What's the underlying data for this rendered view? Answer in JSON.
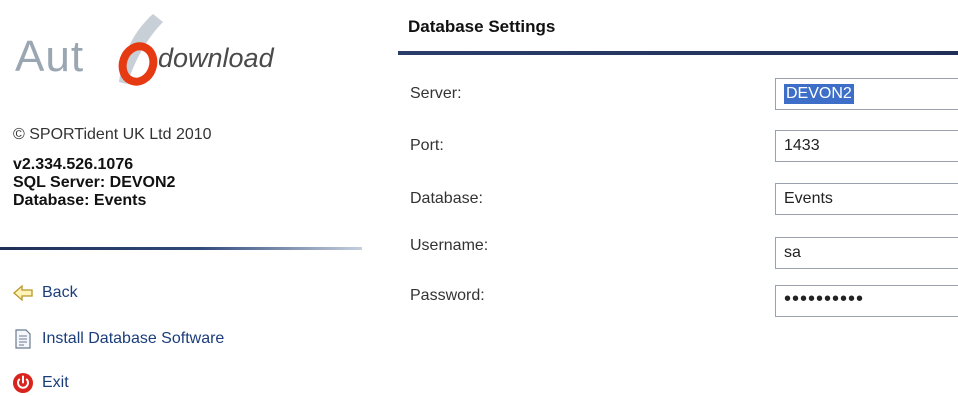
{
  "brand": {
    "logo_left": "Aut",
    "logo_right": "download",
    "accent_color": "#e63a12"
  },
  "about": {
    "copyright": "© SPORTident UK Ltd 2010",
    "version": "v2.334.526.1076",
    "sql_server": "SQL Server:  DEVON2",
    "database": "Database: Events"
  },
  "nav": {
    "back": {
      "label": "Back",
      "icon": "back-arrow-icon"
    },
    "install": {
      "label": "Install Database Software",
      "icon": "document-icon"
    },
    "exit": {
      "label": "Exit",
      "icon": "power-icon"
    }
  },
  "settings": {
    "title": "Database Settings",
    "server": {
      "label": "Server:",
      "value": "DEVON2"
    },
    "port": {
      "label": "Port:",
      "value": "1433"
    },
    "database": {
      "label": "Database:",
      "value": "Events"
    },
    "username": {
      "label": "Username:",
      "value": "sa"
    },
    "password": {
      "label": "Password:",
      "value": "••••••••••"
    }
  }
}
